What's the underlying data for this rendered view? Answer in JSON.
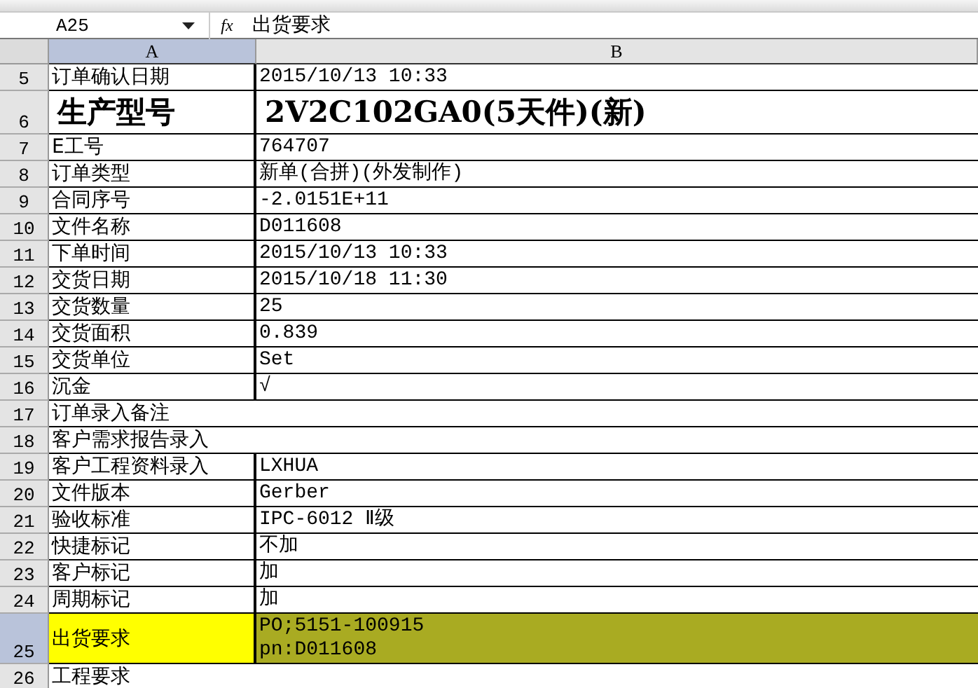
{
  "name_box": "A25",
  "function_label": "fx",
  "formula": "出货要求",
  "columns": [
    {
      "label": "A",
      "selected": true
    },
    {
      "label": "B",
      "selected": false
    }
  ],
  "rows": [
    {
      "number": "5",
      "a": "订单确认日期",
      "b": "2015/10/13 10:33",
      "kind": "normal",
      "selected": false
    },
    {
      "number": "6",
      "a": "生产型号",
      "b": "2V2C102GA0(5天件)(新)",
      "kind": "heading",
      "selected": false
    },
    {
      "number": "7",
      "a": "E工号",
      "b": "764707",
      "kind": "normal",
      "selected": false
    },
    {
      "number": "8",
      "a": "订单类型",
      "b": "新单(合拼)(外发制作)",
      "kind": "normal",
      "selected": false
    },
    {
      "number": "9",
      "a": "合同序号",
      "b": "-2.0151E+11",
      "kind": "normal",
      "selected": false
    },
    {
      "number": "10",
      "a": "文件名称",
      "b": "D011608",
      "kind": "normal",
      "selected": false
    },
    {
      "number": "11",
      "a": "下单时间",
      "b": "2015/10/13 10:33",
      "kind": "normal",
      "selected": false
    },
    {
      "number": "12",
      "a": "交货日期",
      "b": "2015/10/18 11:30",
      "kind": "normal",
      "selected": false
    },
    {
      "number": "13",
      "a": "交货数量",
      "b": "25",
      "kind": "normal",
      "selected": false
    },
    {
      "number": "14",
      "a": "交货面积",
      "b": "0.839",
      "kind": "normal",
      "selected": false
    },
    {
      "number": "15",
      "a": "交货单位",
      "b": "Set",
      "kind": "normal",
      "selected": false
    },
    {
      "number": "16",
      "a": "沉金",
      "b": "√",
      "kind": "normal",
      "selected": false
    },
    {
      "number": "17",
      "a": "订单录入备注",
      "kind": "normal",
      "selected": false
    },
    {
      "number": "18",
      "a": "客户需求报告录入",
      "kind": "normal",
      "selected": false
    },
    {
      "number": "19",
      "a": "客户工程资料录入",
      "b": "LXHUA",
      "kind": "normal",
      "selected": false
    },
    {
      "number": "20",
      "a": "文件版本",
      "b": "Gerber",
      "kind": "normal",
      "selected": false
    },
    {
      "number": "21",
      "a": "验收标准",
      "b": "IPC-6012 Ⅱ级",
      "kind": "normal",
      "selected": false
    },
    {
      "number": "22",
      "a": "快捷标记",
      "b": "不加",
      "kind": "normal",
      "selected": false
    },
    {
      "number": "23",
      "a": "客户标记",
      "b": "加",
      "kind": "normal",
      "selected": false
    },
    {
      "number": "24",
      "a": "周期标记",
      "b": "加",
      "kind": "normal",
      "selected": false
    },
    {
      "number": "25",
      "a": "出货要求",
      "b_lines": [
        "PO;5151-100915",
        "pn:D011608"
      ],
      "kind": "tall",
      "selected": true,
      "a_fill": {
        "color": "#ffff00"
      },
      "b_fill": {
        "color": "#a9ab22"
      }
    },
    {
      "number": "26",
      "a": "工程要求",
      "kind": "normal",
      "selected": false
    }
  ]
}
